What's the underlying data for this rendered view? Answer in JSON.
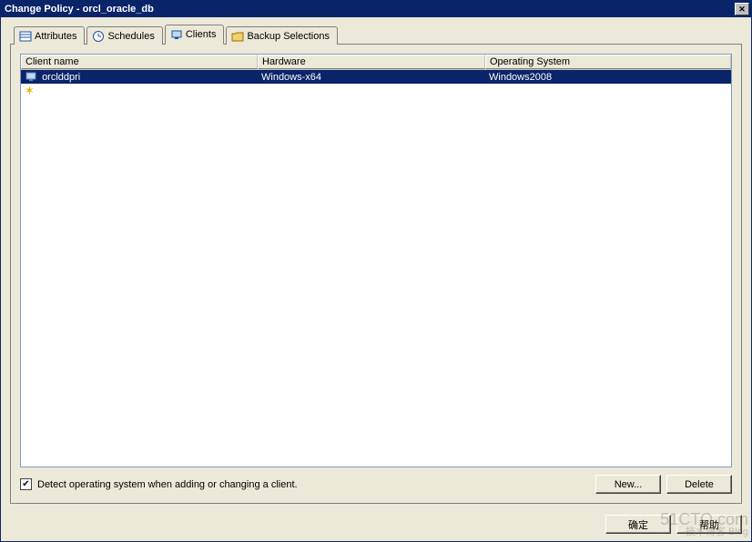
{
  "title": "Change Policy - orcl_oracle_db",
  "close_glyph": "✕",
  "tabs": [
    {
      "label": "Attributes",
      "icon": "attributes-icon"
    },
    {
      "label": "Schedules",
      "icon": "schedules-icon"
    },
    {
      "label": "Clients",
      "icon": "clients-icon"
    },
    {
      "label": "Backup Selections",
      "icon": "backup-sel-icon"
    }
  ],
  "active_tab": 2,
  "list": {
    "columns": [
      "Client name",
      "Hardware",
      "Operating System"
    ],
    "rows": [
      {
        "client": "orclddpri",
        "hardware": "Windows-x64",
        "os": "Windows2008",
        "selected": true
      }
    ]
  },
  "detect_checkbox": {
    "checked": true,
    "label": "Detect operating system when adding or changing a client."
  },
  "buttons": {
    "new": "New...",
    "delete": "Delete"
  },
  "dialog_buttons": {
    "ok": "确定",
    "help": "帮助"
  },
  "watermark": {
    "line1": "51CTO.com",
    "line2": "技术博客  Blog"
  }
}
